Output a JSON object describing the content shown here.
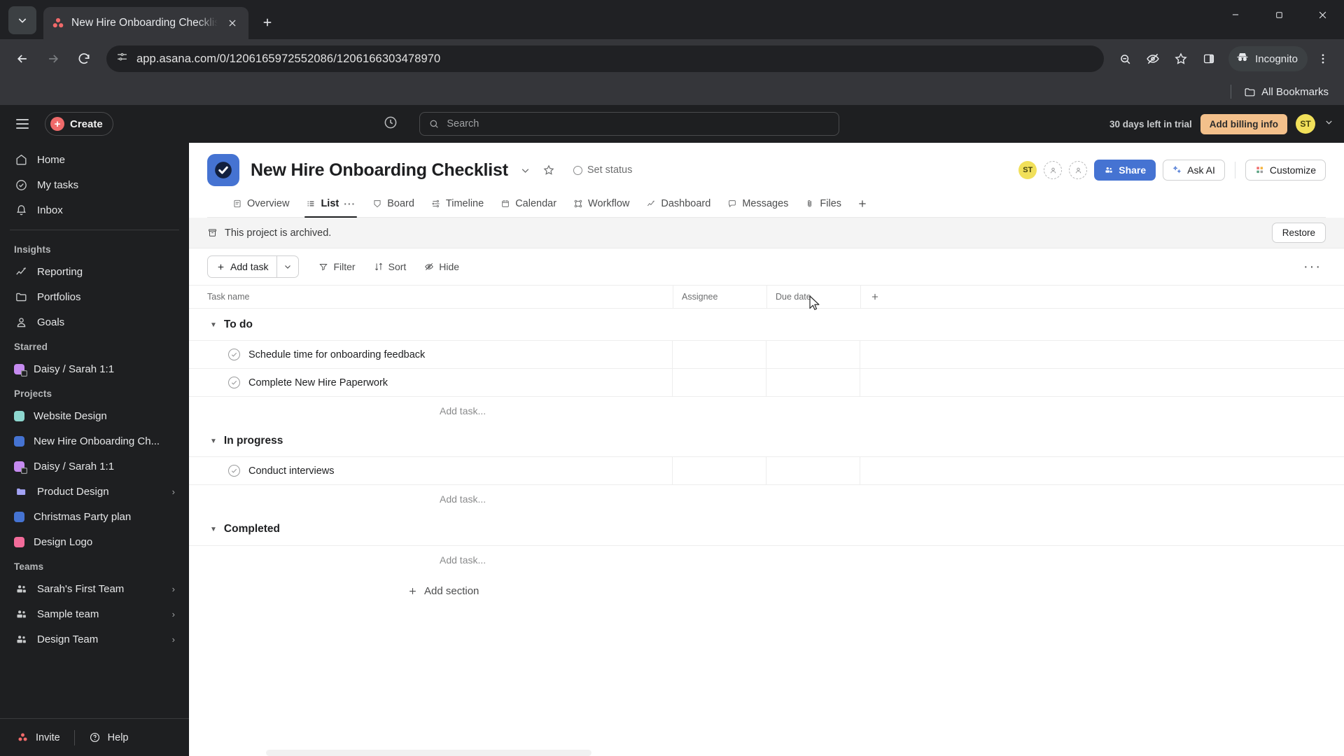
{
  "browser": {
    "tab": {
      "title": "New Hire Onboarding Checklist",
      "favicon": "asana-logo-icon"
    },
    "new_tab_label": "+",
    "url": "app.asana.com/0/1206165972552086/1206166303478970",
    "incognito_label": "Incognito",
    "bookmarks_label": "All Bookmarks",
    "window_controls": {
      "minimize": "minimize-icon",
      "maximize": "maximize-icon",
      "close": "close-icon"
    }
  },
  "topbar": {
    "create_label": "Create",
    "search_placeholder": "Search",
    "trial_text": "30 days left in trial",
    "billing_label": "Add billing info",
    "avatar_initials": "ST"
  },
  "sidebar": {
    "primary": [
      {
        "label": "Home",
        "icon": "home-icon"
      },
      {
        "label": "My tasks",
        "icon": "check-circle-icon"
      },
      {
        "label": "Inbox",
        "icon": "bell-icon"
      }
    ],
    "insights_heading": "Insights",
    "insights": [
      {
        "label": "Reporting",
        "icon": "chart-line-icon"
      },
      {
        "label": "Portfolios",
        "icon": "folder-icon"
      },
      {
        "label": "Goals",
        "icon": "goal-icon"
      }
    ],
    "starred_heading": "Starred",
    "starred": [
      {
        "label": "Daisy / Sarah 1:1",
        "color": "#c58af0",
        "locked": true
      }
    ],
    "projects_heading": "Projects",
    "projects": [
      {
        "label": "Website Design",
        "color": "#8dd7cf",
        "locked": false,
        "expandable": false
      },
      {
        "label": "New Hire Onboarding Ch...",
        "color": "#4573d2",
        "locked": false,
        "expandable": false
      },
      {
        "label": "Daisy / Sarah 1:1",
        "color": "#c58af0",
        "locked": true,
        "expandable": false
      },
      {
        "label": "Product Design",
        "color": "#a3a3f5",
        "locked": false,
        "expandable": true,
        "is_folder": true
      },
      {
        "label": "Christmas Party plan",
        "color": "#4573d2",
        "locked": false,
        "expandable": false
      },
      {
        "label": "Design Logo",
        "color": "#f26b9a",
        "locked": false,
        "expandable": false
      }
    ],
    "teams_heading": "Teams",
    "teams": [
      {
        "label": "Sarah's First Team",
        "icon": "people-icon",
        "expandable": true
      },
      {
        "label": "Sample team",
        "icon": "people-icon",
        "expandable": true
      },
      {
        "label": "Design Team",
        "icon": "people-icon",
        "expandable": true
      }
    ],
    "invite_label": "Invite",
    "help_label": "Help"
  },
  "project": {
    "title": "New Hire Onboarding Checklist",
    "set_status_label": "Set status",
    "members": [
      {
        "initials": "ST",
        "color": "#f1e05a"
      },
      {
        "initials": "",
        "ghost": true
      },
      {
        "initials": "",
        "ghost": true
      }
    ],
    "share_label": "Share",
    "ask_ai_label": "Ask AI",
    "customize_label": "Customize",
    "tabs": [
      {
        "label": "Overview",
        "icon": "overview-icon",
        "active": false
      },
      {
        "label": "List",
        "icon": "list-icon",
        "active": true
      },
      {
        "label": "Board",
        "icon": "board-icon",
        "active": false
      },
      {
        "label": "Timeline",
        "icon": "timeline-icon",
        "active": false
      },
      {
        "label": "Calendar",
        "icon": "calendar-icon",
        "active": false
      },
      {
        "label": "Workflow",
        "icon": "workflow-icon",
        "active": false
      },
      {
        "label": "Dashboard",
        "icon": "dashboard-icon",
        "active": false
      },
      {
        "label": "Messages",
        "icon": "messages-icon",
        "active": false
      },
      {
        "label": "Files",
        "icon": "files-icon",
        "active": false
      }
    ],
    "tab_overflow": "···",
    "archived_text": "This project is archived.",
    "restore_label": "Restore"
  },
  "list_toolbar": {
    "add_task_label": "Add task",
    "filter_label": "Filter",
    "sort_label": "Sort",
    "hide_label": "Hide",
    "more_label": "···"
  },
  "table": {
    "columns": [
      "Task name",
      "Assignee",
      "Due date"
    ],
    "add_column_label": "+",
    "add_task_placeholder": "Add task...",
    "add_section_label": "Add section",
    "sections": [
      {
        "name": "To do",
        "collapsed": false,
        "tasks": [
          {
            "name": "Schedule time for onboarding feedback",
            "assignee": "",
            "due_date": ""
          },
          {
            "name": "Complete New Hire Paperwork",
            "assignee": "",
            "due_date": ""
          }
        ]
      },
      {
        "name": "In progress",
        "collapsed": false,
        "tasks": [
          {
            "name": "Conduct interviews",
            "assignee": "",
            "due_date": ""
          }
        ]
      },
      {
        "name": "Completed",
        "collapsed": false,
        "tasks": []
      }
    ]
  },
  "colors": {
    "asana_blue": "#4573d2",
    "asana_coral": "#f06a6a",
    "trial_orange": "#f3c08b",
    "avatar_yellow": "#f1e05a",
    "sidebar_bg": "#1e1f21",
    "chrome_bg": "#35363a"
  }
}
